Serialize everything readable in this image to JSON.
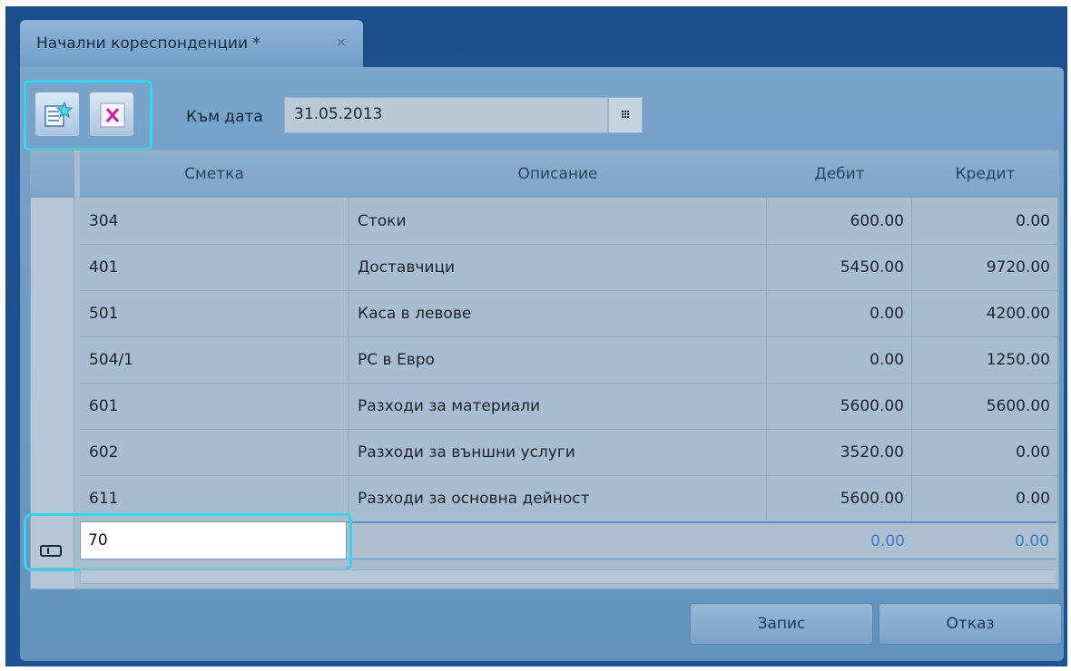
{
  "tab": {
    "title": "Начални кореспонденции *",
    "close_glyph": "⨯"
  },
  "toolbar": {
    "add_icon": "add-row-icon",
    "delete_icon": "delete-row-icon",
    "date_label": "Към дата",
    "date_value": "31.05.2013",
    "calendar_icon": "calendar-icon"
  },
  "grid": {
    "columns": [
      "Сметка",
      "Описание",
      "Дебит",
      "Кредит"
    ],
    "rows": [
      {
        "account": "304",
        "description": "Стоки",
        "debit": "600.00",
        "credit": "0.00"
      },
      {
        "account": "401",
        "description": "Доставчици",
        "debit": "5450.00",
        "credit": "9720.00"
      },
      {
        "account": "501",
        "description": "Каса в левове",
        "debit": "0.00",
        "credit": "4200.00"
      },
      {
        "account": "504/1",
        "description": "РС в Евро",
        "debit": "0.00",
        "credit": "1250.00"
      },
      {
        "account": "601",
        "description": "Разходи за материали",
        "debit": "5600.00",
        "credit": "5600.00"
      },
      {
        "account": "602",
        "description": "Разходи за външни услуги",
        "debit": "3520.00",
        "credit": "0.00"
      },
      {
        "account": "611",
        "description": "Разходи за основна дейност",
        "debit": "5600.00",
        "credit": "0.00"
      }
    ],
    "new_row": {
      "account": "70",
      "debit": "0.00",
      "credit": "0.00"
    }
  },
  "actions": {
    "save_label": "Запис",
    "cancel_label": "Отказ"
  },
  "colors": {
    "window_bg": "#1b4f8c",
    "panel_bg": "#6d9bc4",
    "highlight": "#39d3ef",
    "new_row_text": "#3d7ad0"
  }
}
